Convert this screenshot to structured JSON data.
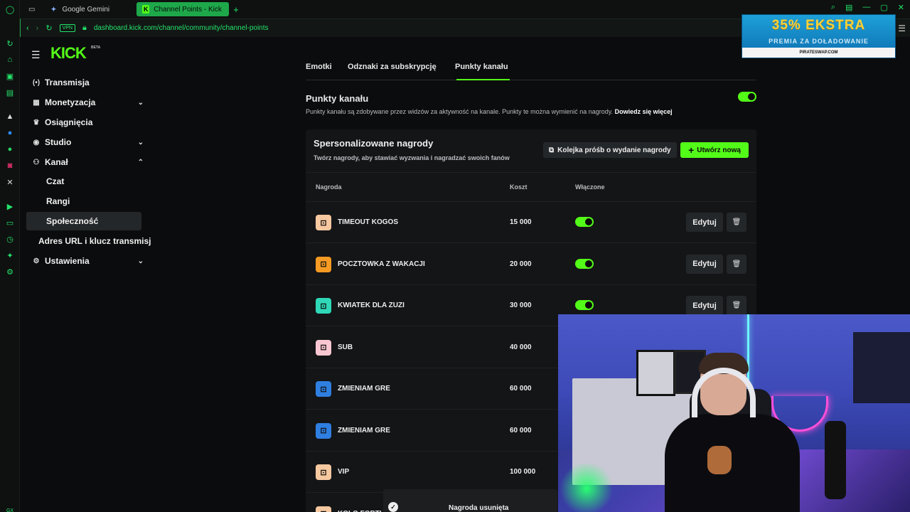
{
  "browser": {
    "tabs": [
      {
        "label": "Google Gemini"
      },
      {
        "label": "Channel Points - Kick Das"
      }
    ],
    "vpn_label": "VPN",
    "url": "dashboard.kick.com/channel/community/channel-points",
    "bottom_label": "GX"
  },
  "ad": {
    "headline": "35% EKSTRA",
    "subline": "PREMIA ZA DOŁADOWANIE",
    "site": "PIRATESWAP.COM"
  },
  "brand": {
    "logo": "KICK",
    "badge": "BETA",
    "accent": "#53fc18"
  },
  "nav": {
    "items": [
      {
        "label": "Transmisja",
        "icon": "broadcast-icon"
      },
      {
        "label": "Monetyzacja",
        "icon": "monetization-icon"
      },
      {
        "label": "Osiągnięcia",
        "icon": "trophy-icon"
      },
      {
        "label": "Studio",
        "icon": "studio-icon"
      },
      {
        "label": "Kanał",
        "icon": "channel-icon"
      }
    ],
    "channel_sub": [
      {
        "label": "Czat"
      },
      {
        "label": "Rangi"
      },
      {
        "label": "Społeczność"
      }
    ],
    "stream_url": "Adres URL i klucz transmisji",
    "settings": "Ustawienia"
  },
  "page_tabs": [
    {
      "label": "Emotki"
    },
    {
      "label": "Odznaki za subskrypcję"
    },
    {
      "label": "Punkty kanału"
    }
  ],
  "section": {
    "title": "Punkty kanału",
    "desc": "Punkty kanału są zdobywane przez widzów za aktywność na kanale. Punkty te można wymienić na nagrody.",
    "link": "Dowiedz się więcej",
    "enabled": true
  },
  "rewards": {
    "title": "Spersonalizowane nagrody",
    "subtitle": "Twórz nagrody, aby stawiać wyzwania i nagradzać swoich fanów",
    "queue_button": "Kolejka próśb o wydanie nagrody",
    "new_button": "Utwórz nową",
    "columns": {
      "name": "Nagroda",
      "cost": "Koszt",
      "enabled": "Włączone"
    },
    "edit_label": "Edytuj",
    "rows": [
      {
        "name": "TIMEOUT KOGOS",
        "cost": "15 000",
        "color": "#f6c89f",
        "enabled": true
      },
      {
        "name": "POCZTOWKA Z WAKACJI",
        "cost": "20 000",
        "color": "#f59a23",
        "enabled": true
      },
      {
        "name": "KWIATEK DLA ZUZI",
        "cost": "30 000",
        "color": "#2fd8b7",
        "enabled": true
      },
      {
        "name": "SUB",
        "cost": "40 000",
        "color": "#f9c7d2",
        "enabled": null
      },
      {
        "name": "ZMIENIAM GRE",
        "cost": "60 000",
        "color": "#2f7fe0",
        "enabled": null
      },
      {
        "name": "ZMIENIAM GRE",
        "cost": "60 000",
        "color": "#2f7fe0",
        "enabled": null
      },
      {
        "name": "VIP",
        "cost": "100 000",
        "color": "#f6c89f",
        "enabled": null
      },
      {
        "name": "KOLO FORTU",
        "cost": "",
        "color": "#f6c89f",
        "enabled": null
      }
    ]
  },
  "toast": {
    "text": "Nagroda usunięta"
  }
}
